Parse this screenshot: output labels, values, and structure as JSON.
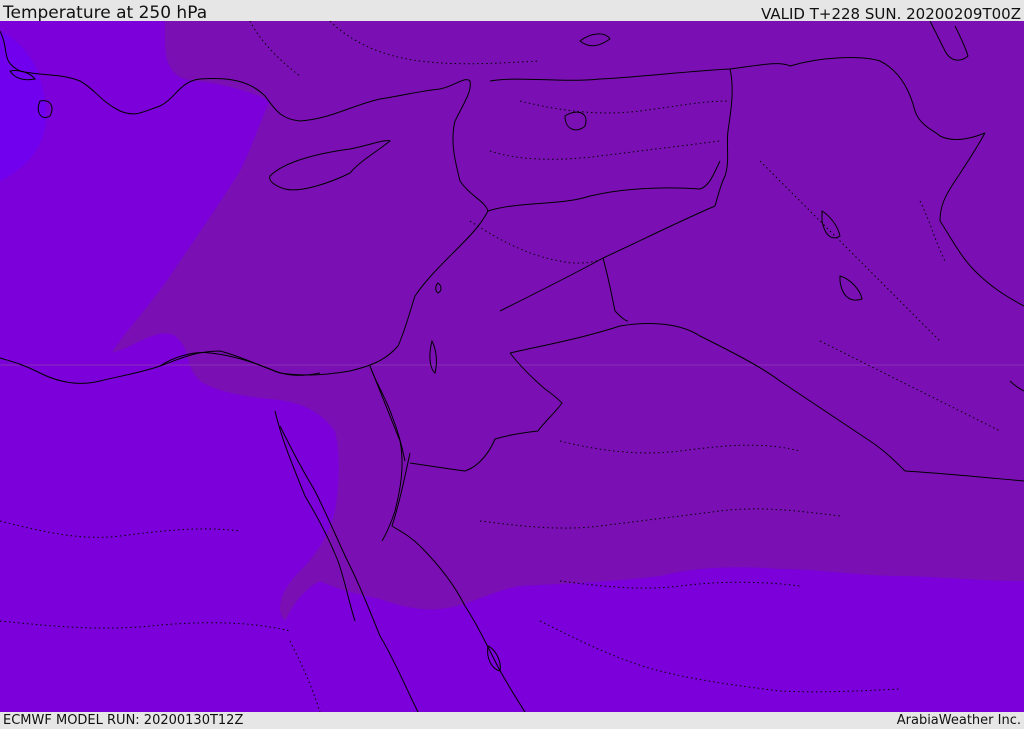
{
  "header": {
    "title": "Temperature at 250 hPa",
    "valid": "VALID T+228 SUN. 20200209T00Z"
  },
  "footer": {
    "model_run": "ECMWF MODEL RUN: 20200130T12Z",
    "brand": "ArabiaWeather Inc."
  },
  "map": {
    "colors": {
      "cold_band": "#7b00d9",
      "warm_band": "#7a10b4",
      "coldest_patch": "#7000ee",
      "coast": "#000000",
      "border": "#000000"
    }
  }
}
